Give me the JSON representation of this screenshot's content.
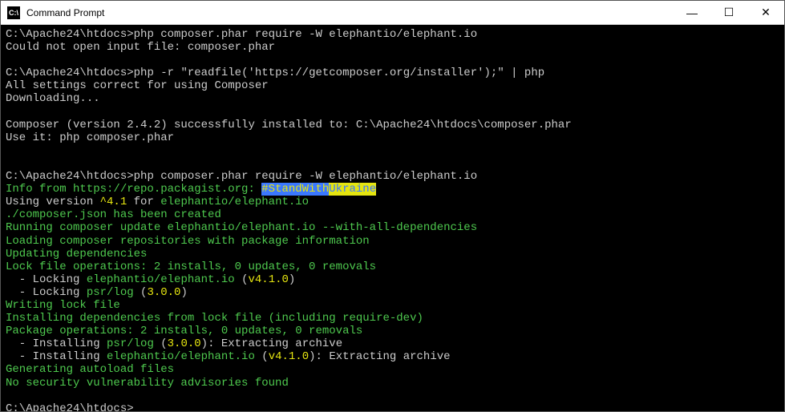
{
  "titlebar": {
    "icon_text": "C:\\",
    "title": "Command Prompt",
    "minimize": "—",
    "maximize": "☐",
    "close": "✕"
  },
  "terminal": {
    "l1_prompt": "C:\\Apache24\\htdocs>",
    "l1_cmd": "php composer.phar require -W elephantio/elephant.io",
    "l2": "Could not open input file: composer.phar",
    "l3_prompt": "C:\\Apache24\\htdocs>",
    "l3_cmd": "php -r \"readfile('https://getcomposer.org/installer');\" | php",
    "l4": "All settings correct for using Composer",
    "l5": "Downloading...",
    "l6": "Composer (version 2.4.2) successfully installed to: C:\\Apache24\\htdocs\\composer.phar",
    "l7": "Use it: php composer.phar",
    "l8_prompt": "C:\\Apache24\\htdocs>",
    "l8_cmd": "php composer.phar require -W elephantio/elephant.io",
    "l9_info": "Info from https://repo.packagist.org: ",
    "l9_stand": "#StandWith",
    "l9_ukraine": "Ukraine",
    "l10_a": "Using version ",
    "l10_b": "^4.1",
    "l10_c": " for ",
    "l10_d": "elephantio/elephant.io",
    "l11": "./composer.json has been created",
    "l12": "Running composer update elephantio/elephant.io --with-all-dependencies",
    "l13": "Loading composer repositories with package information",
    "l14": "Updating dependencies",
    "l15": "Lock file operations: 2 installs, 0 updates, 0 removals",
    "l16_a": "  - Locking ",
    "l16_b": "elephantio/elephant.io",
    "l16_c": " (",
    "l16_d": "v4.1.0",
    "l16_e": ")",
    "l17_a": "  - Locking ",
    "l17_b": "psr/log",
    "l17_c": " (",
    "l17_d": "3.0.0",
    "l17_e": ")",
    "l18": "Writing lock file",
    "l19": "Installing dependencies from lock file (including require-dev)",
    "l20": "Package operations: 2 installs, 0 updates, 0 removals",
    "l21_a": "  - Installing ",
    "l21_b": "psr/log",
    "l21_c": " (",
    "l21_d": "3.0.0",
    "l21_e": "): Extracting archive",
    "l22_a": "  - Installing ",
    "l22_b": "elephantio/elephant.io",
    "l22_c": " (",
    "l22_d": "v4.1.0",
    "l22_e": "): Extracting archive",
    "l23": "Generating autoload files",
    "l24": "No security vulnerability advisories found",
    "l25_prompt": "C:\\Apache24\\htdocs>"
  }
}
